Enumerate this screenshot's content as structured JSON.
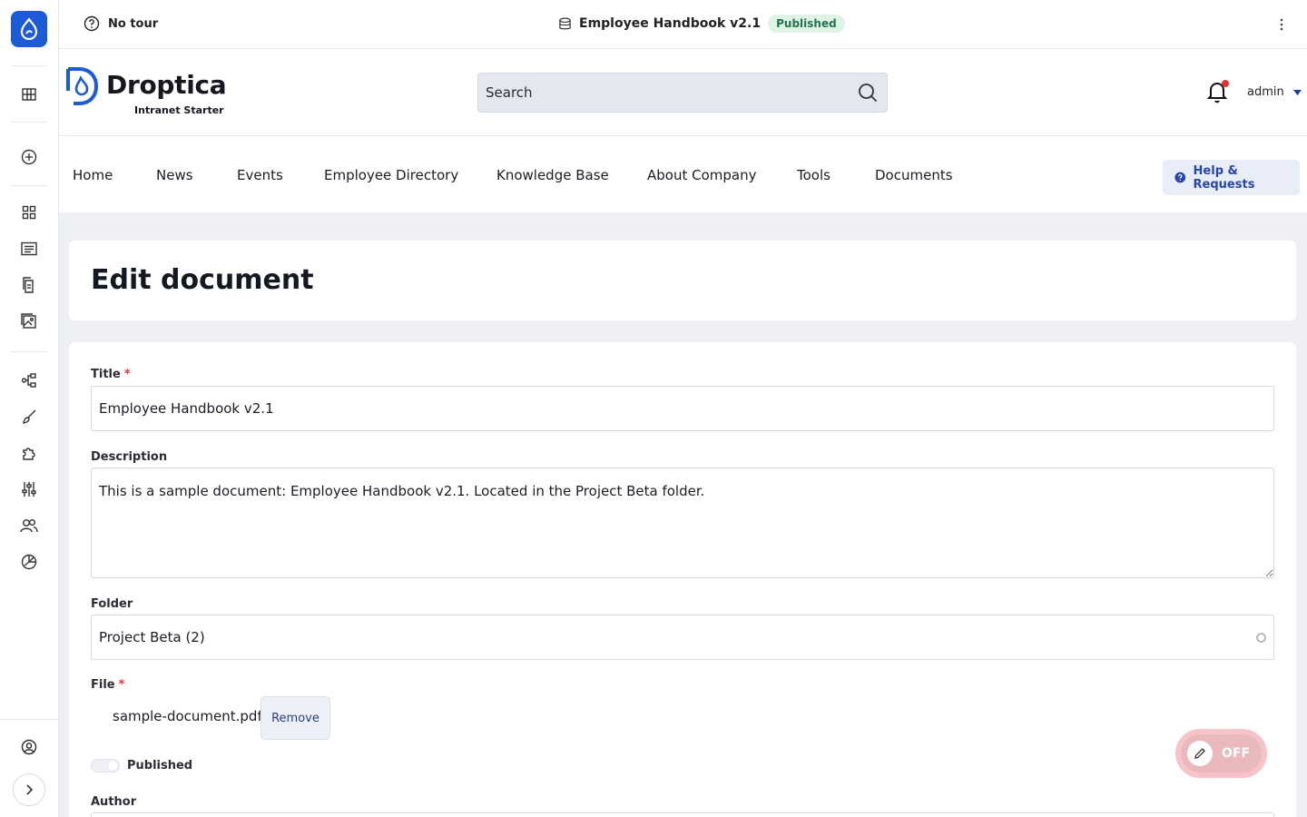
{
  "toolbar": {
    "tour_label": "No tour",
    "document_title": "Employee Handbook v2.1",
    "status_badge": "Published"
  },
  "brand": {
    "name": "Droptica",
    "subtitle": "Intranet Starter",
    "color": "#1d5bd6"
  },
  "search": {
    "placeholder": "Search"
  },
  "user": {
    "name": "admin",
    "has_notifications": true
  },
  "nav": {
    "items": [
      {
        "label": "Home"
      },
      {
        "label": "News"
      },
      {
        "label": "Events"
      },
      {
        "label": "Employee Directory"
      },
      {
        "label": "Knowledge Base"
      },
      {
        "label": "About Company"
      },
      {
        "label": "Tools"
      },
      {
        "label": "Documents"
      }
    ],
    "help_label": "Help & Requests"
  },
  "rail": {
    "icons": [
      "drupal-icon",
      "layout-icon",
      "add-icon",
      "dashboard-icon",
      "content-icon",
      "documents-icon",
      "media-icon",
      "structure-icon",
      "appearance-icon",
      "extend-icon",
      "configuration-icon",
      "people-icon",
      "reports-icon",
      "user-profile-icon",
      "expand-icon"
    ]
  },
  "page": {
    "heading": "Edit document"
  },
  "form": {
    "title_label": "Title",
    "title_value": "Employee Handbook v2.1",
    "description_label": "Description",
    "description_value": "This is a sample document: Employee Handbook v2.1. Located in the Project Beta folder.",
    "folder_label": "Folder",
    "folder_value": "Project Beta (2)",
    "file_label": "File",
    "file_name": "sample-document.pdf",
    "remove_label": "Remove",
    "published_label": "Published",
    "published": false,
    "author_label": "Author"
  },
  "edit_mode": {
    "label": "OFF",
    "enabled": false
  }
}
